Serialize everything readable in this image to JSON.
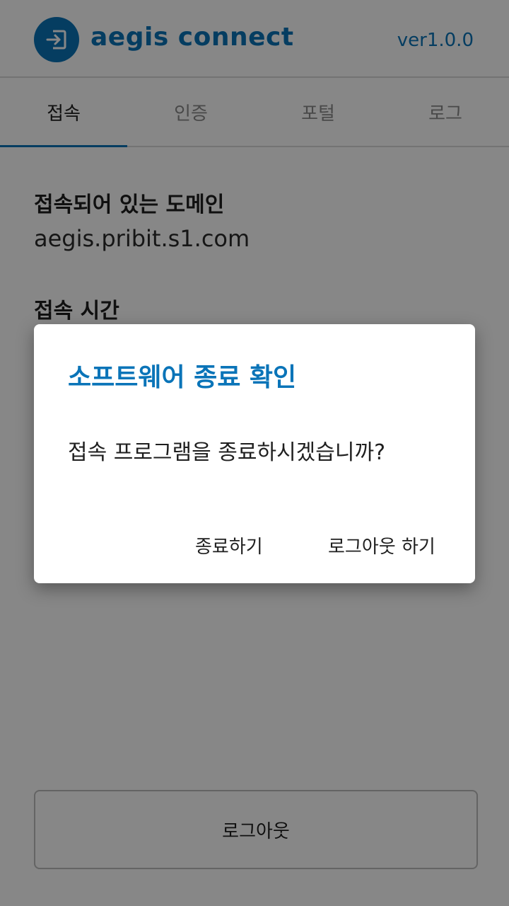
{
  "header": {
    "app_title": "aegis connect",
    "version": "ver1.0.0",
    "logo_icon": "login-arrow-icon",
    "brand_color": "#0a74b8"
  },
  "tabs": [
    {
      "label": "접속",
      "active": true
    },
    {
      "label": "인증",
      "active": false
    },
    {
      "label": "포털",
      "active": false
    },
    {
      "label": "로그",
      "active": false
    }
  ],
  "main": {
    "domain_label": "접속되어 있는 도메인",
    "domain_value": "aegis.pribit.s1.com",
    "time_label": "접속 시간",
    "logout_button": "로그아웃"
  },
  "dialog": {
    "title": "소프트웨어 종료 확인",
    "message": "접속 프로그램을 종료하시겠습니까?",
    "exit_button": "종료하기",
    "logout_button": "로그아웃 하기"
  }
}
